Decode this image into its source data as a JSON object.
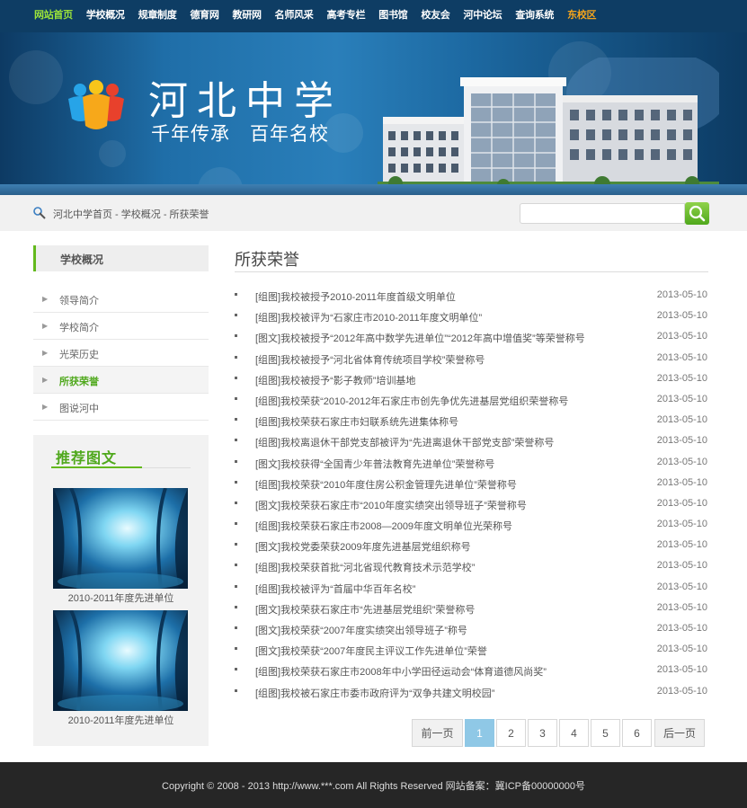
{
  "nav": {
    "items": [
      {
        "label": "网站首页",
        "color": "#9be23a"
      },
      {
        "label": "学校概况",
        "color": "#ffffff"
      },
      {
        "label": "规章制度",
        "color": "#ffffff"
      },
      {
        "label": "德育网",
        "color": "#ffffff"
      },
      {
        "label": "教研网",
        "color": "#ffffff"
      },
      {
        "label": "名师风采",
        "color": "#ffffff"
      },
      {
        "label": "高考专栏",
        "color": "#ffffff"
      },
      {
        "label": "图书馆",
        "color": "#ffffff"
      },
      {
        "label": "校友会",
        "color": "#ffffff"
      },
      {
        "label": "河中论坛",
        "color": "#ffffff"
      },
      {
        "label": "查询系统",
        "color": "#ffffff"
      },
      {
        "label": "东校区",
        "color": "#f4a41c"
      }
    ]
  },
  "banner": {
    "title": "河北中学",
    "slogan": "千年传承　百年名校"
  },
  "breadcrumb": "河北中学首页 - 学校概况 - 所获荣誉",
  "search": {
    "placeholder": "",
    "value": ""
  },
  "sidebar": {
    "heading": "学校概况",
    "items": [
      {
        "label": "领导简介",
        "active": false
      },
      {
        "label": "学校简介",
        "active": false
      },
      {
        "label": "光荣历史",
        "active": false
      },
      {
        "label": "所获荣誉",
        "active": true
      },
      {
        "label": "图说河中",
        "active": false
      }
    ],
    "recommend": {
      "title": "推荐图文",
      "items": [
        {
          "caption": "2010-2011年度先进单位"
        },
        {
          "caption": "2010-2011年度先进单位"
        }
      ]
    }
  },
  "main": {
    "title": "所获荣誉",
    "news": [
      {
        "title": "[组图]我校被授予2010-2011年度首级文明单位",
        "date": "2013-05-10"
      },
      {
        "title": "[组图]我校被评为“石家庄市2010-2011年度文明单位”",
        "date": "2013-05-10"
      },
      {
        "title": "[图文]我校被授予“2012年高中数学先进单位”“2012年高中增值奖”等荣誉称号",
        "date": "2013-05-10"
      },
      {
        "title": "[组图]我校被授予“河北省体育传统项目学校”荣誉称号",
        "date": "2013-05-10"
      },
      {
        "title": "[组图]我校被授予“影子教师”培训基地",
        "date": "2013-05-10"
      },
      {
        "title": "[组图]我校荣获“2010-2012年石家庄市创先争优先进基层党组织荣誉称号",
        "date": "2013-05-10"
      },
      {
        "title": "[组图]我校荣获石家庄市妇联系统先进集体称号",
        "date": "2013-05-10"
      },
      {
        "title": "[组图]我校离退休干部党支部被评为“先进离退休干部党支部”荣誉称号",
        "date": "2013-05-10"
      },
      {
        "title": "[图文]我校获得“全国青少年普法教育先进单位”荣誉称号",
        "date": "2013-05-10"
      },
      {
        "title": "[组图]我校荣获“2010年度住房公积金管理先进单位”荣誉称号",
        "date": "2013-05-10"
      },
      {
        "title": "[图文]我校荣获石家庄市“2010年度实绩突出领导班子”荣誉称号",
        "date": "2013-05-10"
      },
      {
        "title": "[组图]我校荣获石家庄市2008—2009年度文明单位光荣称号",
        "date": "2013-05-10"
      },
      {
        "title": "[图文]我校党委荣获2009年度先进基层党组织称号",
        "date": "2013-05-10"
      },
      {
        "title": "[组图]我校荣获首批“河北省现代教育技术示范学校”",
        "date": "2013-05-10"
      },
      {
        "title": "[组图]我校被评为“首届中华百年名校”",
        "date": "2013-05-10"
      },
      {
        "title": "[图文]我校荣获石家庄市“先进基层党组织”荣誉称号",
        "date": "2013-05-10"
      },
      {
        "title": "[图文]我校荣获“2007年度实绩突出领导班子”称号",
        "date": "2013-05-10"
      },
      {
        "title": "[图文]我校荣获“2007年度民主评议工作先进单位”荣誉",
        "date": "2013-05-10"
      },
      {
        "title": "[组图]我校荣获石家庄市2008年中小学田径运动会“体育道德风尚奖”",
        "date": "2013-05-10"
      },
      {
        "title": "[组图]我校被石家庄市委市政府评为“双争共建文明校园”",
        "date": "2013-05-10"
      }
    ]
  },
  "pagination": {
    "prev": "前一页",
    "pages": [
      "1",
      "2",
      "3",
      "4",
      "5",
      "6"
    ],
    "current": "1",
    "next": "后一页"
  },
  "footer": "Copyright © 2008 - 2013 http://www.***.com All Rights Reserved 网站备案：冀ICP备00000000号",
  "colors": {
    "accent": "#63b91d",
    "nav_bg": "#0e3d64",
    "footer_bg": "#262626",
    "pager_current": "#8fc8e6"
  }
}
